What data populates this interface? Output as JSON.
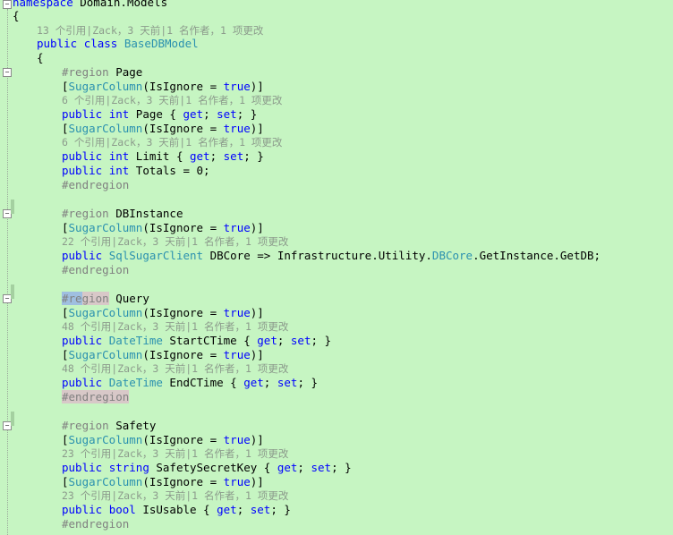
{
  "code": {
    "namespace_kw": "namespace",
    "namespace_name": " Domain.Models",
    "open_brace": "{",
    "close_brace_inner": "{",
    "class_lens": "13 个引用|Zack，3 天前|1 名作者，1 项更改",
    "class_public": "public",
    "class_kw": "class",
    "class_name": "BaseDBModel",
    "attr_name": "SugarColumn",
    "attr_args": "(IsIgnore = ",
    "attr_true": "true",
    "attr_close": ")]",
    "attr_open": "[",
    "region_kw": "#region",
    "endregion_kw": "#endregion",
    "regions": {
      "page": {
        "title": " Page",
        "lens1": "6 个引用|Zack，3 天前|1 名作者，1 项更改",
        "line1_public": "public",
        "line1_type": "int",
        "line1_rest": " Page { ",
        "lens2": "6 个引用|Zack，3 天前|1 名作者，1 项更改",
        "line2_rest": " Limit { ",
        "line3_rest": " Totals = 0;"
      },
      "dbinstance": {
        "title": " DBInstance",
        "lens1": "22 个引用|Zack，3 天前|1 名作者，1 项更改",
        "type": "SqlSugarClient",
        "rest1": " DBCore => Infrastructure.Utility.",
        "dbcore": "DBCore",
        "rest2": ".GetInstance.GetDB;"
      },
      "query": {
        "title": " Query",
        "region_part1": "#re",
        "region_part2": "gion",
        "lens1": "48 个引用|Zack，3 天前|1 名作者，1 项更改",
        "type": "DateTime",
        "rest1": " StartCTime { ",
        "lens2": "48 个引用|Zack，3 天前|1 名作者，1 项更改",
        "rest2": " EndCTime { "
      },
      "safety": {
        "title": " Safety",
        "lens1": "23 个引用|Zack，3 天前|1 名作者，1 项更改",
        "type1": "string",
        "rest1": " SafetySecretKey { ",
        "lens2": "23 个引用|Zack，3 天前|1 名作者，1 项更改",
        "type2": "bool",
        "rest2": " IsUsable { "
      }
    },
    "get": "get",
    "set": "set",
    "semi_space": "; ",
    "accessor_close": "; }"
  },
  "colors": {
    "background": "#c6f5c2",
    "keyword": "#0000ff",
    "type": "#2b91af",
    "preprocessor": "#808080",
    "codelens": "#8c9b8c"
  },
  "icons": {
    "fold": "minus-box-icon"
  }
}
